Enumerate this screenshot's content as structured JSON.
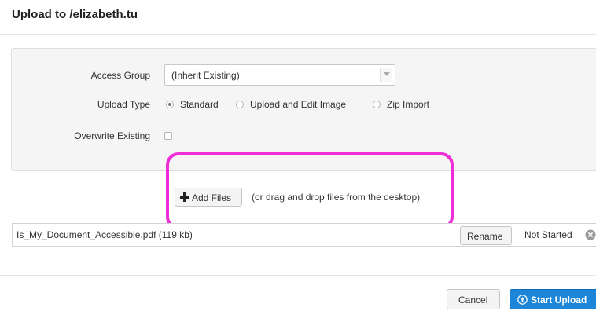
{
  "dialog": {
    "title": "Upload to /elizabeth.tu"
  },
  "access_group": {
    "label": "Access Group",
    "value": "(Inherit Existing)"
  },
  "upload_type": {
    "label": "Upload Type",
    "options": [
      {
        "label": "Standard",
        "selected": true
      },
      {
        "label": "Upload and Edit Image",
        "selected": false
      },
      {
        "label": "Zip Import",
        "selected": false
      }
    ]
  },
  "overwrite": {
    "label": "Overwrite Existing",
    "checked": false
  },
  "add_files": {
    "label": "Add Files",
    "hint": "(or drag and drop files from the desktop)"
  },
  "highlight_color": "#ee2ed6",
  "files": [
    {
      "name": "Is_My_Document_Accessible.pdf (119 kb)",
      "rename_label": "Rename",
      "status": "Not Started"
    }
  ],
  "footer": {
    "cancel_label": "Cancel",
    "start_label": "Start Upload"
  },
  "colors": {
    "primary": "#1d86d8",
    "panel_bg": "#f5f5f5"
  },
  "icons": [
    "plus-icon",
    "chevron-down-icon",
    "remove-icon",
    "upload-icon"
  ]
}
